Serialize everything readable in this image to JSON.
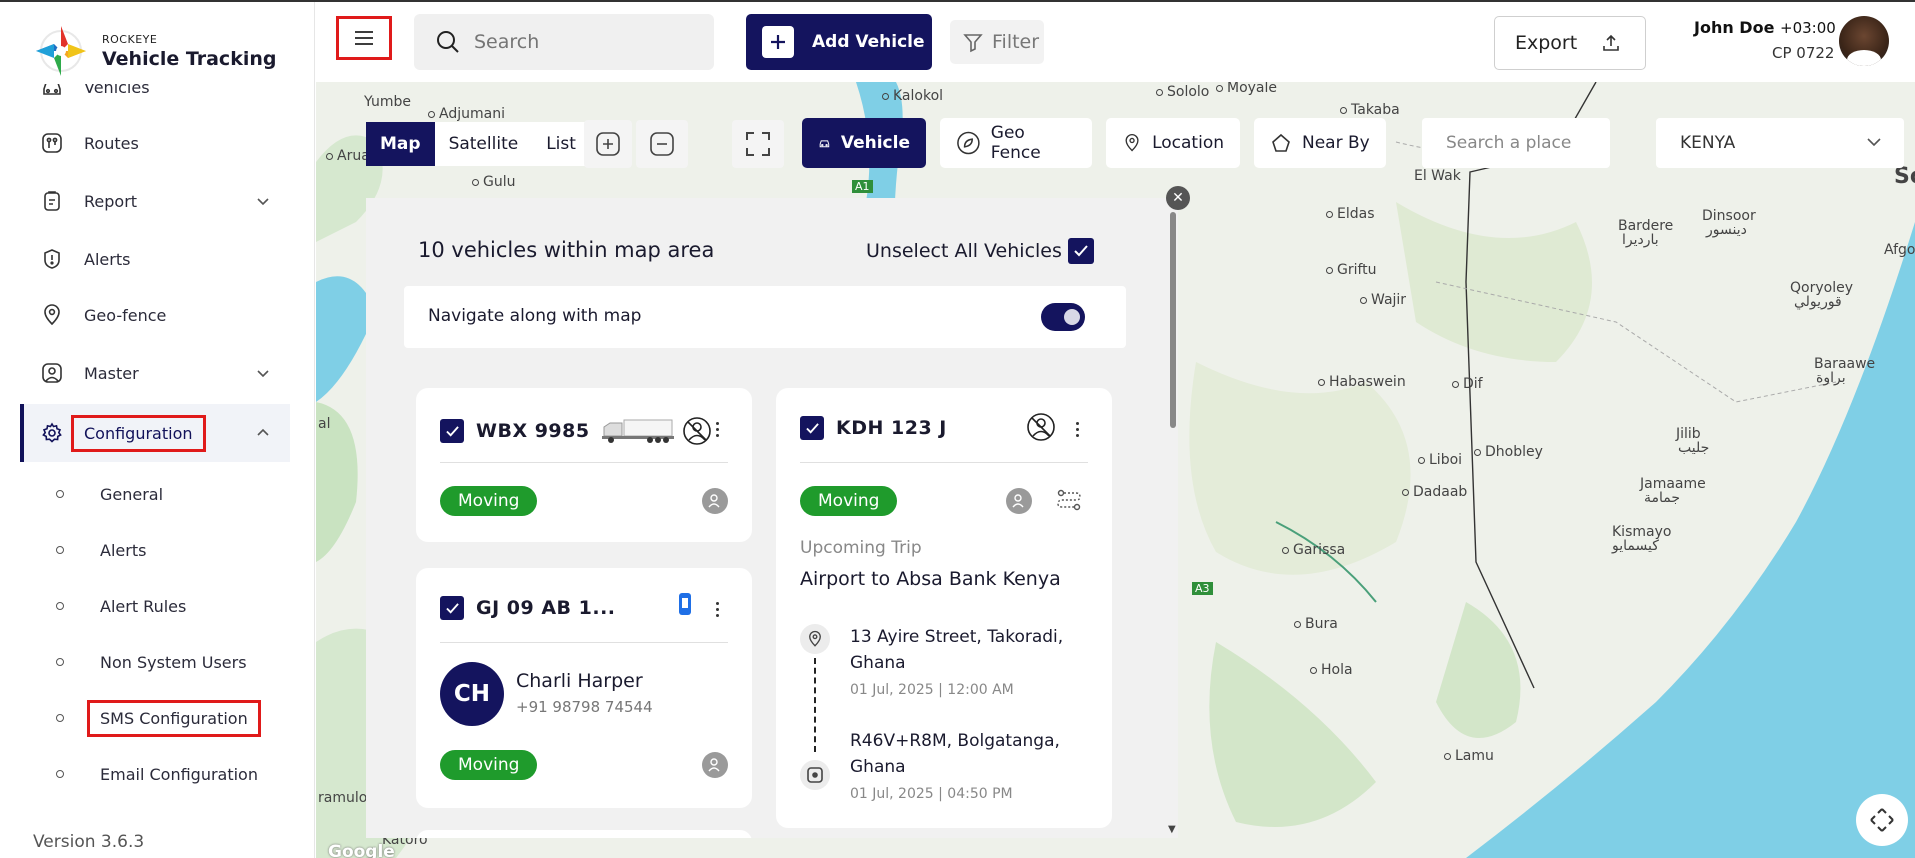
{
  "brand": {
    "company": "ROCKEYE",
    "product": "Vehicle Tracking"
  },
  "sidebar": {
    "items": [
      {
        "label": "Vehicles"
      },
      {
        "label": "Routes"
      },
      {
        "label": "Report"
      },
      {
        "label": "Alerts"
      },
      {
        "label": "Geo-fence"
      },
      {
        "label": "Master"
      },
      {
        "label": "Configuration"
      }
    ],
    "sub_items": [
      {
        "label": "General"
      },
      {
        "label": "Alerts"
      },
      {
        "label": "Alert Rules"
      },
      {
        "label": "Non System Users"
      },
      {
        "label": "SMS Configuration"
      },
      {
        "label": "Email Configuration"
      }
    ],
    "version": "Version 3.6.3"
  },
  "header": {
    "search_placeholder": "Search",
    "add_vehicle": "Add Vehicle",
    "filter": "Filter",
    "export": "Export",
    "user_name": "John Doe",
    "timezone": "+03:00",
    "user_code": "CP 0722"
  },
  "map_controls": {
    "view_tabs": [
      "Map",
      "Satellite",
      "List"
    ],
    "active_view": "Map",
    "layers": [
      "Vehicle",
      "Geo Fence",
      "Location",
      "Near By"
    ],
    "active_layer": "Vehicle",
    "place_search_placeholder": "Search a place",
    "country": "KENYA"
  },
  "map_labels": [
    "Yumbe",
    "Adjumani",
    "Arua",
    "Gulu",
    "Kalokol",
    "Sololo",
    "Moyale",
    "Takaba",
    "El Wak",
    "Eldas",
    "Griftu",
    "Wajir",
    "Bardere",
    "باردیرا",
    "Dinsoor",
    "دينسور",
    "Qoryoley",
    "قوريولي",
    "Afgo",
    "Habaswein",
    "Dif",
    "Baraawe",
    "براوة",
    "Jilib",
    "جليب",
    "Liboi",
    "Dhobley",
    "Dadaab",
    "Jamaame",
    "جمامة",
    "Kismayo",
    "كيسمايو",
    "Garissa",
    "Bura",
    "Hola",
    "Lamu",
    "A1",
    "A3",
    "Katoro",
    "ramulo",
    "al",
    "So"
  ],
  "panel": {
    "title": "10 vehicles within map area",
    "unselect_all": "Unselect All Vehicles",
    "navigate_label": "Navigate along with map",
    "navigate_on": true,
    "vehicles": [
      {
        "plate": "WBX 9985",
        "status": "Moving"
      },
      {
        "plate": "GJ 09 AB 1...",
        "status": "Moving",
        "driver_initials": "CH",
        "driver_name": "Charli Harper",
        "driver_phone": "+91 98798 74544"
      },
      {
        "plate": "KDH 123 J",
        "status": "Moving",
        "trip_label": "Upcoming Trip",
        "trip_name": "Airport to Absa Bank Kenya",
        "origin": "13 Ayire Street, Takoradi, Ghana",
        "origin_time": "01 Jul, 2025 | 12:00 AM",
        "destination": "R46V+R8M, Bolgatanga, Ghana",
        "destination_time": "01 Jul, 2025 | 04:50 PM"
      }
    ]
  },
  "colors": {
    "primary": "#14145e",
    "moving": "#1f9b2c",
    "highlight": "#e01a1a",
    "water": "#7fcfe6",
    "land": "#eef1ea"
  },
  "attribution": "Google"
}
